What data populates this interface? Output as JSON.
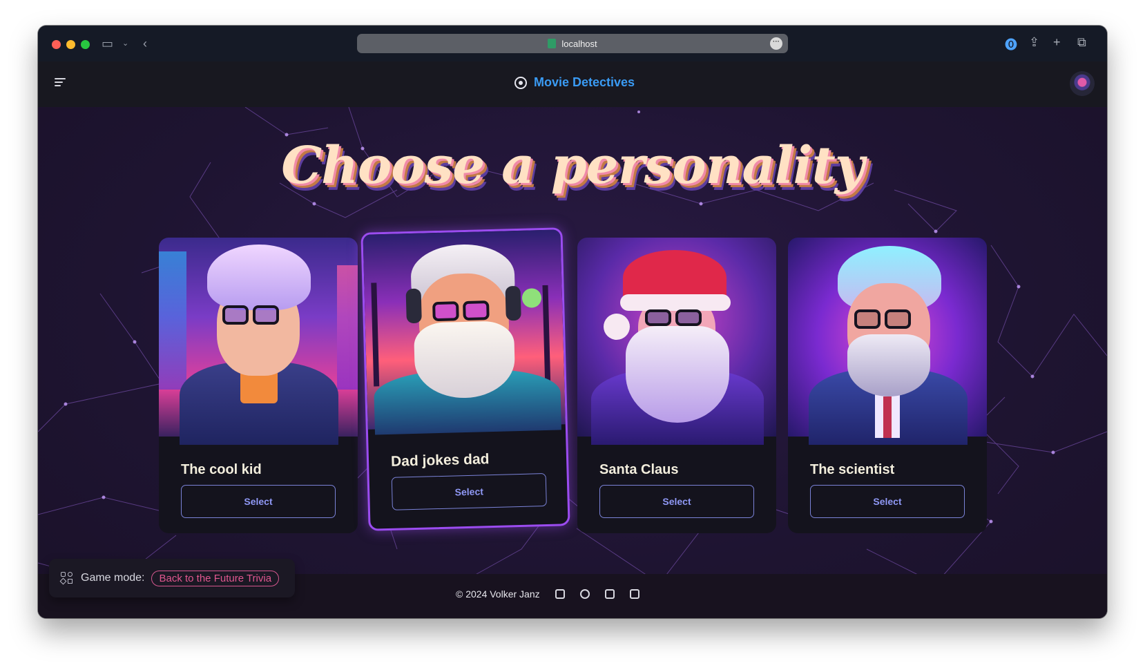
{
  "browser": {
    "url": "localhost",
    "icons": [
      "sidebar-icon",
      "chevron-down-icon",
      "back-icon",
      "more-icon",
      "password-icon",
      "share-icon",
      "new-tab-icon",
      "tabs-overview-icon"
    ]
  },
  "header": {
    "title": "Movie Detectives",
    "icons": [
      "menu-icon",
      "film-reel-icon",
      "user-avatar"
    ]
  },
  "page": {
    "heading": "Choose a personality"
  },
  "personalities": [
    {
      "name": "The cool kid",
      "button": "Select",
      "selected": false
    },
    {
      "name": "Dad jokes dad",
      "button": "Select",
      "selected": true
    },
    {
      "name": "Santa Claus",
      "button": "Select",
      "selected": false
    },
    {
      "name": "The scientist",
      "button": "Select",
      "selected": false
    }
  ],
  "game_mode": {
    "label": "Game mode:",
    "value": "Back to the Future Trivia"
  },
  "footer": {
    "copyright": "© 2024 Volker Janz",
    "links": [
      "calendar-icon",
      "github-icon",
      "linkedin-icon",
      "medium-icon"
    ]
  },
  "colors": {
    "accent_blue": "#3a9bf4",
    "selected_border": "#9b4cf0",
    "button_text": "#8f98f5",
    "pill": "#e0578f"
  }
}
